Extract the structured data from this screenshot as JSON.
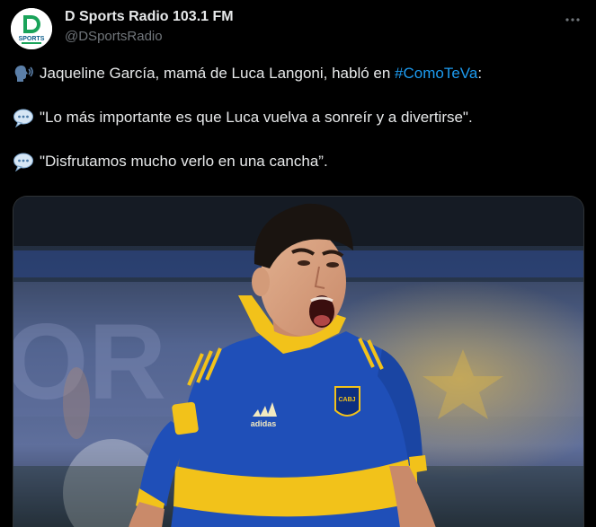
{
  "account": {
    "display_name": "D Sports Radio 103.1 FM",
    "handle": "@DSportsRadio",
    "avatar_logo_text": "SPORTS"
  },
  "tweet": {
    "line1_before": "Jaqueline García, mamá de Luca Langoni, habló en ",
    "line1_hashtag": "#ComoTeVa",
    "line1_after": ":",
    "line2": "\"Lo más importante es que Luca vuelva a sonreír y a divertirse\".",
    "line3": "\"Disfrutamos mucho verlo en una cancha”.",
    "icons": {
      "line1": "speaking-head-icon",
      "line2": "speech-balloon-icon",
      "line3": "speech-balloon-icon"
    }
  },
  "media": {
    "kind": "photo",
    "subject": "football player in blue and yellow jersey shouting",
    "jersey_brand_text": "adidas"
  },
  "colors": {
    "background": "#000000",
    "text": "#e7e9ea",
    "muted": "#71767b",
    "link": "#1d9bf0",
    "jersey_blue": "#1f4fb8",
    "jersey_yellow": "#f2c21a"
  }
}
